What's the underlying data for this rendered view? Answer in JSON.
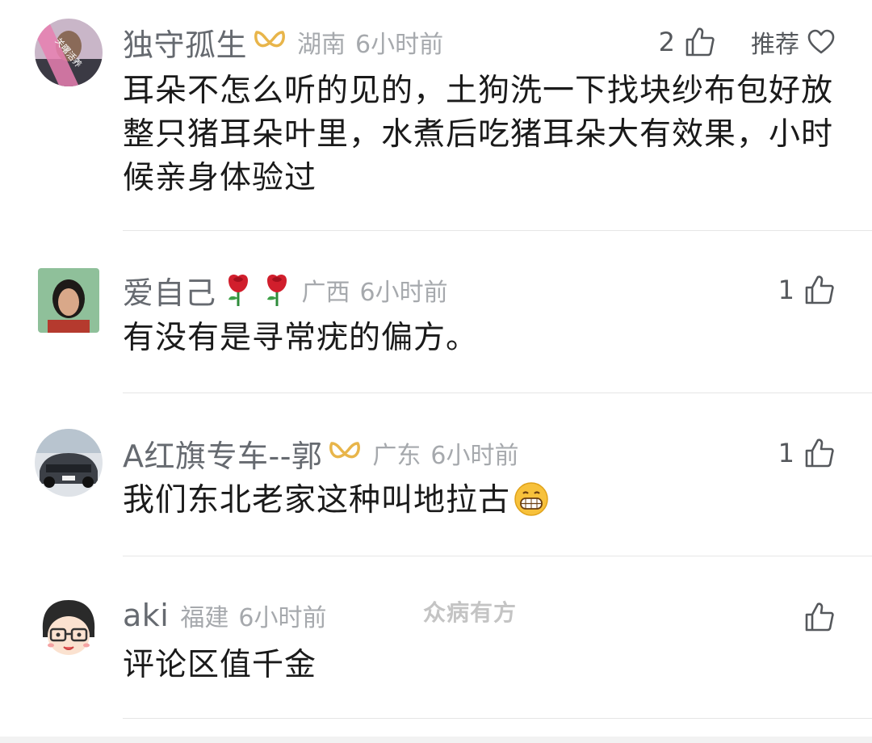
{
  "comments": [
    {
      "username": "独守孤生",
      "location": "湖南",
      "time": "6小时前",
      "like_count": "2",
      "recommend_label": "推荐",
      "text": "耳朵不怎么听的见的，土狗洗一下找块纱布包好放整只猪耳朵叶里，水煮后吃猪耳朵大有效果，小时候亲身体验过",
      "avatar_text": "关曙活养"
    },
    {
      "username": "爱自己",
      "location": "广西",
      "time": "6小时前",
      "like_count": "1",
      "text": "有没有是寻常疣的偏方。"
    },
    {
      "username": "A红旗专车--郭",
      "location": "广东",
      "time": "6小时前",
      "like_count": "1",
      "text": "我们东北老家这种叫地拉古"
    },
    {
      "username": "aki",
      "location": "福建",
      "time": "6小时前",
      "like_count": "",
      "text": "评论区值千金"
    }
  ],
  "watermark": "众病有方",
  "icons": {
    "thumb": "thumbs-up-icon",
    "heart": "heart-icon",
    "badge": "gold-ribbon-badge-icon",
    "rose": "rose-emoji-icon",
    "grin": "grinning-emoji-icon"
  },
  "colors": {
    "username": "#666a70",
    "meta": "#a6a9ad",
    "text": "#1a1a1a",
    "badge_gold": "#e8b54a",
    "divider": "#e6e6e6"
  }
}
